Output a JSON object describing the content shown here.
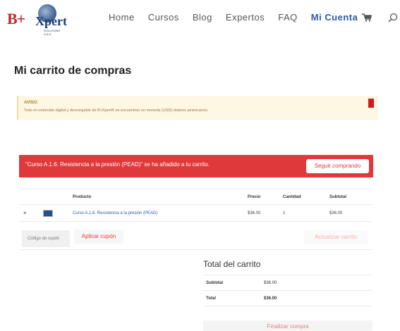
{
  "brand": {
    "logo_text": "B+Xpert",
    "logo_prefix": "B+",
    "logo_suffix": "Xpert",
    "logo_sub": "SOLUTIONS S.A.S."
  },
  "nav": {
    "items": [
      {
        "label": "Home",
        "active": false
      },
      {
        "label": "Cursos",
        "active": false
      },
      {
        "label": "Blog",
        "active": false
      },
      {
        "label": "Expertos",
        "active": false
      },
      {
        "label": "FAQ",
        "active": false
      },
      {
        "label": "Mi Cuenta",
        "active": true
      }
    ]
  },
  "page_title": "Mi carrito de compras",
  "notice": {
    "title": "AVISO:",
    "text": "Todo el contenido digital y descargable de B+Xpert® se encuentran en moneda (USD) dolares americanos."
  },
  "alert": {
    "message": "\"Curso A.1.6. Resistencia a la presión (PEAD)\" se ha añadido a tu carrito.",
    "button": "Seguir comprando"
  },
  "cart": {
    "headers": {
      "product": "Producto",
      "price": "Precio",
      "qty": "Cantidad",
      "subtotal": "Subtotal"
    },
    "rows": [
      {
        "remove": "×",
        "product": "Curso A.1.6. Resistencia a la presión (PEAD)",
        "price": "$36.00",
        "qty": "1",
        "subtotal": "$36.00"
      }
    ]
  },
  "actions": {
    "coupon_placeholder": "Código de cupón",
    "apply_coupon": "Aplicar cupón",
    "update_cart": "Actualizar carrito"
  },
  "totals": {
    "title": "Total del carrito",
    "subtotal_label": "Subtotal",
    "subtotal_value": "$36.00",
    "total_label": "Total",
    "total_value": "$36.00"
  },
  "checkout": {
    "label": "Finalizar compra"
  },
  "colors": {
    "accent": "#e0393b",
    "nav_active": "#2e5aa8",
    "notice_bg": "#fdf7e3"
  }
}
